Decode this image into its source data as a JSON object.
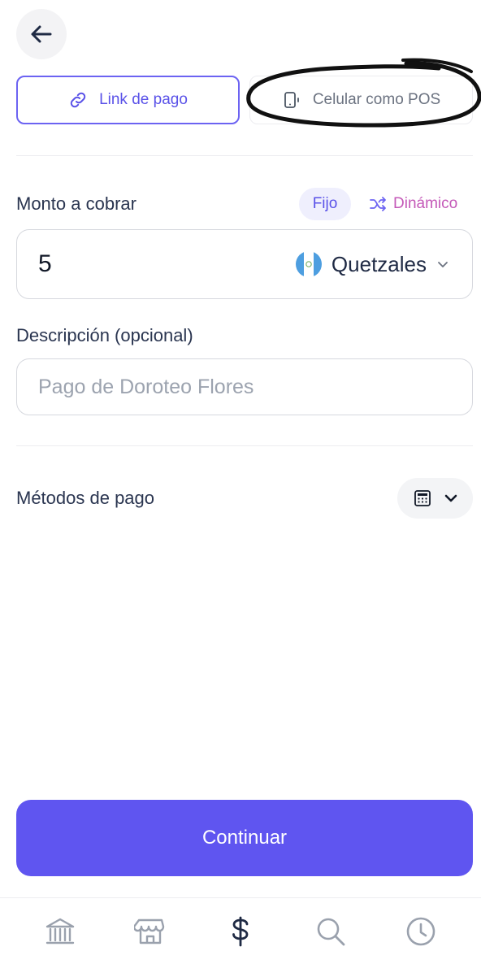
{
  "modes": {
    "link_label": "Link de pago",
    "pos_label": "Celular como POS"
  },
  "amount": {
    "label": "Monto a cobrar",
    "fijo_label": "Fijo",
    "dinamico_label": "Dinámico",
    "value": "5",
    "currency_name": "Quetzales"
  },
  "description": {
    "label": "Descripción (opcional)",
    "placeholder": "Pago de Doroteo Flores"
  },
  "methods": {
    "label": "Métodos de pago"
  },
  "continue_label": "Continuar",
  "colors": {
    "accent": "#5f55f0",
    "dinamico": "#c459b8",
    "flag_blue": "#4d9ee0"
  },
  "tabbar": {
    "items": [
      "bank-icon",
      "store-icon",
      "dollar-icon",
      "search-icon",
      "clock-icon"
    ],
    "active": "dollar-icon"
  }
}
